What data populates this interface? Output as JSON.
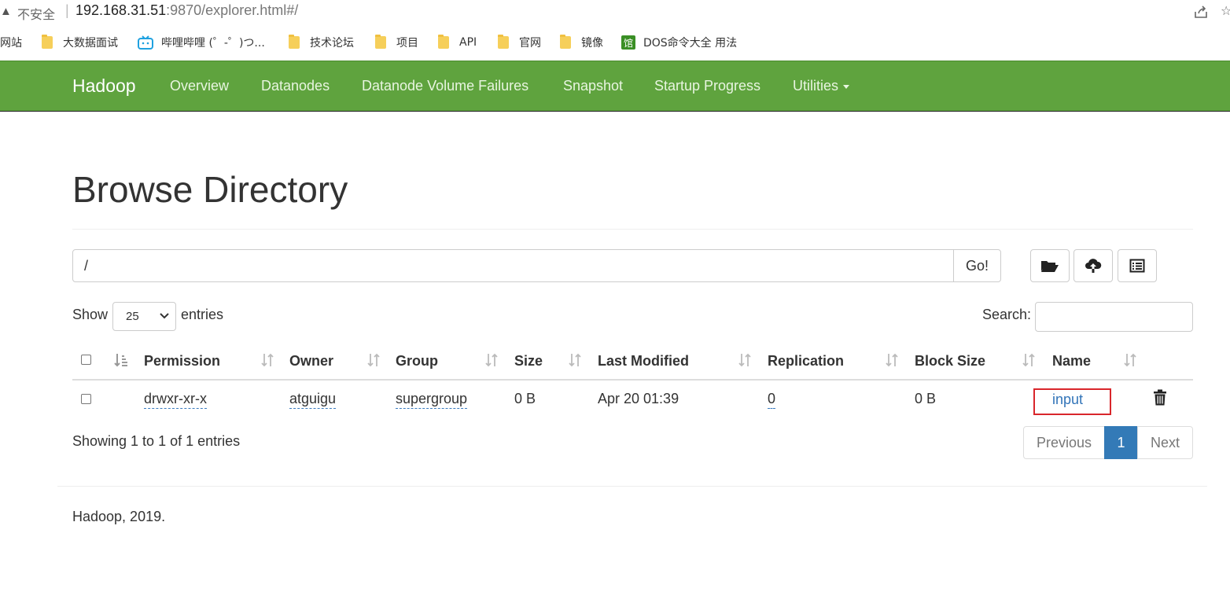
{
  "browser": {
    "insecure_label": "不安全",
    "separator": "|",
    "url_host": "192.168.31.51",
    "url_rest": ":9870/explorer.html#/",
    "bookmarks": [
      {
        "label": "网站",
        "icon": "none"
      },
      {
        "label": "大数据面试",
        "icon": "folder-icon"
      },
      {
        "label": "哔哩哔哩 (゜-゜)つ...",
        "icon": "bilibili-icon"
      },
      {
        "label": "技术论坛",
        "icon": "folder-icon"
      },
      {
        "label": "项目",
        "icon": "folder-icon"
      },
      {
        "label": "API",
        "icon": "folder-icon"
      },
      {
        "label": "官网",
        "icon": "folder-icon"
      },
      {
        "label": "镜像",
        "icon": "folder-icon"
      },
      {
        "label": "DOS命令大全 用法",
        "icon": "guan-icon"
      }
    ],
    "guan_glyph": "馆"
  },
  "navbar": {
    "brand": "Hadoop",
    "items": [
      "Overview",
      "Datanodes",
      "Datanode Volume Failures",
      "Snapshot",
      "Startup Progress",
      "Utilities"
    ],
    "color": "#5fa33e"
  },
  "main": {
    "title": "Browse Directory",
    "path_value": "/",
    "go_label": "Go!",
    "toolbar_icons": [
      "folder-open-icon",
      "cloud-upload-icon",
      "list-alt-icon"
    ],
    "show_label": "Show",
    "entries_value": "25",
    "entries_label": "entries",
    "search_label": "Search:",
    "search_value": ""
  },
  "table": {
    "columns": [
      "Permission",
      "Owner",
      "Group",
      "Size",
      "Last Modified",
      "Replication",
      "Block Size",
      "Name"
    ],
    "rows": [
      {
        "permission": "drwxr-xr-x",
        "owner": "atguigu",
        "group": "supergroup",
        "size": "0 B",
        "last_modified": "Apr 20 01:39",
        "replication": "0",
        "block_size": "0 B",
        "name": "input"
      }
    ],
    "showing": "Showing 1 to 1 of 1 entries"
  },
  "pagination": {
    "previous": "Previous",
    "current": "1",
    "next": "Next",
    "active_color": "#337ab7"
  },
  "footer": {
    "text": "Hadoop, 2019."
  }
}
